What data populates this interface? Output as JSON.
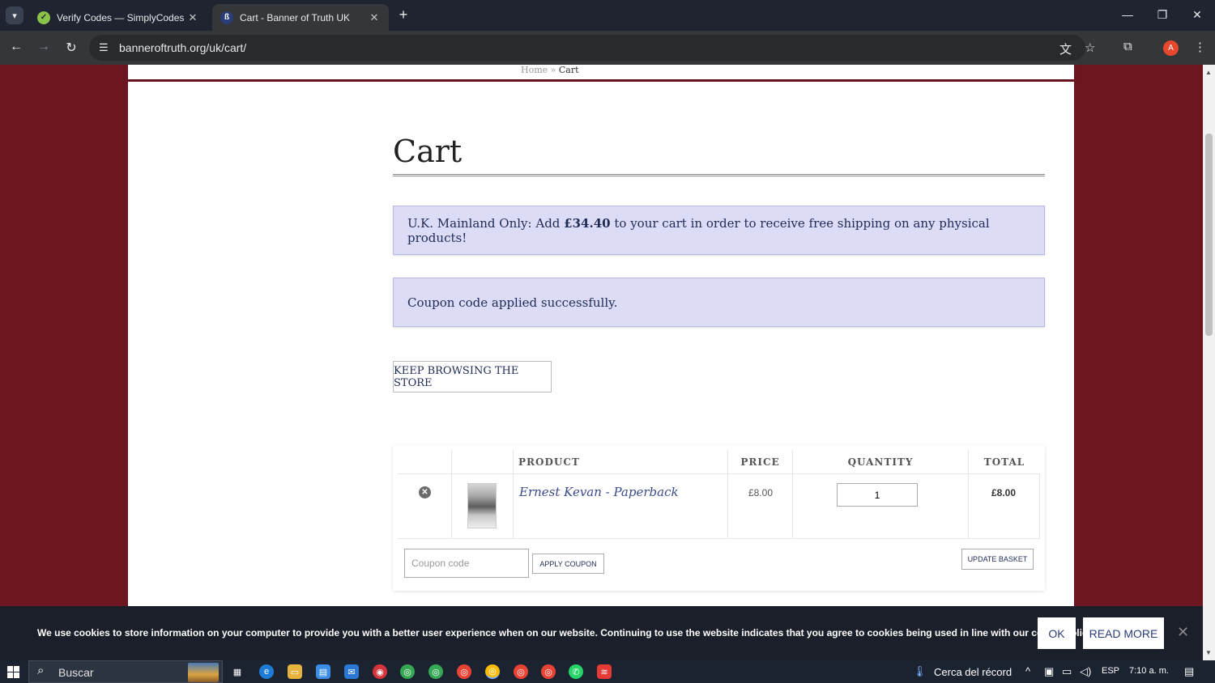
{
  "browser": {
    "tabs": [
      {
        "title": "Verify Codes — SimplyCodes",
        "active": false,
        "favicon": "simplycodes-icon"
      },
      {
        "title": "Cart - Banner of Truth UK",
        "active": true,
        "favicon": "banner-of-truth-icon"
      }
    ],
    "url": "banneroftruth.org/uk/cart/",
    "profile_initial": "A"
  },
  "breadcrumb": {
    "home": "Home",
    "separator": "»",
    "current": "Cart"
  },
  "page": {
    "title": "Cart",
    "shipping_notice": {
      "prefix": "U.K. Mainland Only: Add ",
      "amount": "£34.40",
      "suffix": " to your cart in order to receive free shipping on any physical products!"
    },
    "coupon_notice": "Coupon code applied successfully.",
    "keep_browsing_label": "KEEP BROWSING THE STORE"
  },
  "cart": {
    "headers": {
      "product": "PRODUCT",
      "price": "PRICE",
      "quantity": "QUANTITY",
      "total": "TOTAL"
    },
    "items": [
      {
        "name": "Ernest Kevan - Paperback",
        "price": "£8.00",
        "quantity": "1",
        "total": "£8.00"
      }
    ],
    "coupon_placeholder": "Coupon code",
    "apply_coupon_label": "APPLY COUPON",
    "update_basket_label": "UPDATE BASKET"
  },
  "cookie_bar": {
    "text": "We use cookies to store information on your computer to provide you with a better user experience when on our website. Continuing to use the website indicates that you agree to cookies being used in line with our cookie policy.",
    "ok_label": "OK",
    "read_more_label": "READ MORE"
  },
  "taskbar": {
    "search_text": "Buscar",
    "weather_text": "Cerca del récord",
    "language": "ESP",
    "time": "7:10 a. m."
  },
  "colors": {
    "site_background": "#6d1620",
    "notice_background": "#dcdcf7",
    "link_color": "#3a4a8a"
  }
}
